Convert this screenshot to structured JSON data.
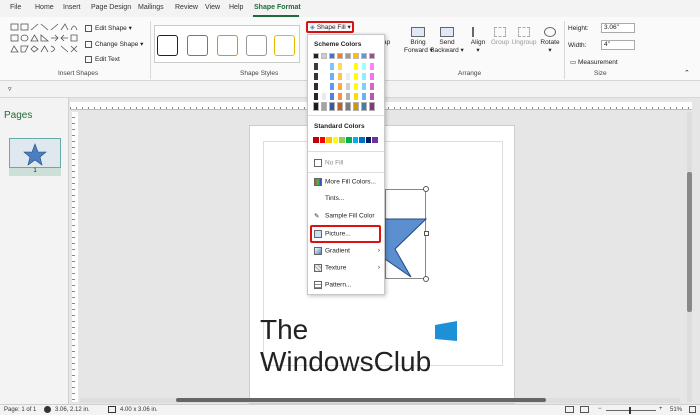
{
  "tabs": [
    "File",
    "Home",
    "Insert",
    "Page Design",
    "Mailings",
    "Review",
    "View",
    "Help",
    "Shape Format"
  ],
  "ribbon": {
    "edit_shape": "Edit Shape",
    "change_shape": "Change Shape",
    "edit_text": "Edit Text",
    "insert_shapes_label": "Insert Shapes",
    "shape_styles_label": "Shape Styles",
    "shape_fill": "Shape Fill",
    "bring_forward": "Bring\nForward",
    "bring_forward_l1": "Bring",
    "bring_forward_l2": "Forward",
    "send_backward_l1": "Send",
    "send_backward_l2": "Backward",
    "align": "Align",
    "group": "Group",
    "ungroup": "Ungroup",
    "rotate": "Rotate",
    "arrange_label": "Arrange",
    "height_label": "Height:",
    "height_value": "3.06\"",
    "width_label": "Width:",
    "width_value": "4\"",
    "measurement": "Measurement",
    "size_label": "Size",
    "wrap_fragment": "ap"
  },
  "dropdown": {
    "scheme_colors": "Scheme Colors",
    "standard_colors": "Standard Colors",
    "no_fill": "No Fill",
    "more_fill_colors": "More Fill Colors...",
    "tints": "Tints...",
    "sample_fill": "Sample Fill Color",
    "picture": "Picture...",
    "gradient": "Gradient",
    "texture": "Texture",
    "pattern": "Pattern..."
  },
  "pages": {
    "title": "Pages",
    "page_number": "1"
  },
  "watermark": {
    "line1": "The",
    "line2": "WindowsClub"
  },
  "status": {
    "page": "Page: 1 of 1",
    "position": "3.06, 2.12 in.",
    "size": "4.00 x 3.06 in.",
    "zoom": "51%"
  },
  "colors": {
    "accent": "#1f6b3a",
    "highlight": "#dd1111",
    "star_fill": "#4a7fc1",
    "shape_fill": "#5b8fd0"
  }
}
